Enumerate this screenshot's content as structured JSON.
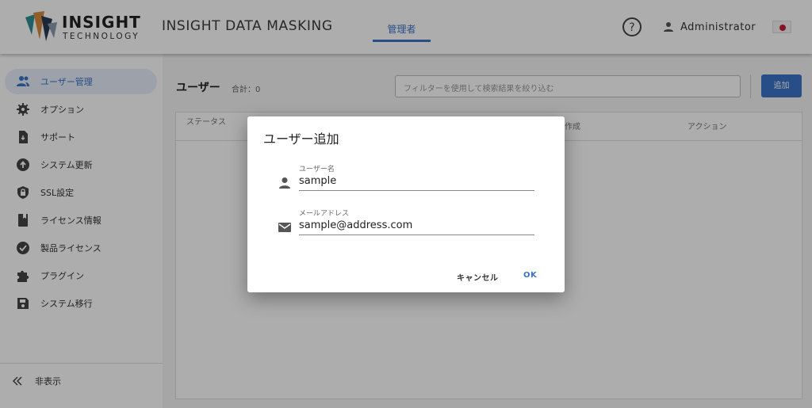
{
  "header": {
    "logo_text": "INSIGHT",
    "logo_sub": "TECHNOLOGY",
    "app_title": "INSIGHT DATA MASKING",
    "nav_tab": "管理者",
    "user_name": "Administrator"
  },
  "sidebar": {
    "items": [
      {
        "label": "ユーザー管理",
        "icon": "users-icon"
      },
      {
        "label": "オプション",
        "icon": "gear-icon"
      },
      {
        "label": "サポート",
        "icon": "document-icon"
      },
      {
        "label": "システム更新",
        "icon": "upgrade-icon"
      },
      {
        "label": "SSL設定",
        "icon": "shield-lock-icon"
      },
      {
        "label": "ライセンス情報",
        "icon": "book-icon"
      },
      {
        "label": "製品ライセンス",
        "icon": "check-circle-icon"
      },
      {
        "label": "プラグイン",
        "icon": "puzzle-icon"
      },
      {
        "label": "システム移行",
        "icon": "save-icon"
      }
    ],
    "hide_label": "非表示"
  },
  "main": {
    "title": "ユーザー",
    "count": "合計：0",
    "filter_placeholder": "フィルターを使用して検索結果を絞り込む",
    "add_label": "追加",
    "columns": [
      "ステータス",
      "作成",
      "アクション"
    ]
  },
  "dialog": {
    "title": "ユーザー追加",
    "username_label": "ユーザー名",
    "username_value": "sample",
    "email_label": "メールアドレス",
    "email_value": "sample@address.com",
    "cancel_label": "キャンセル",
    "ok_label": "OK"
  },
  "colors": {
    "accent": "#3b73c9",
    "overlay": "rgba(0,0,0,0.32)"
  }
}
